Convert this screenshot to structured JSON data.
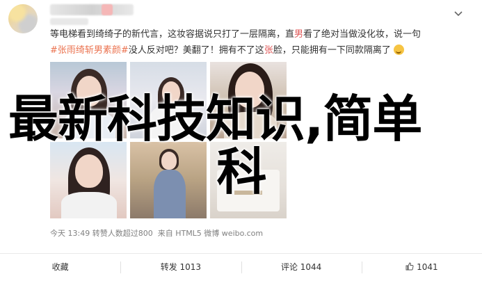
{
  "post": {
    "line1": "等电梯看到绮绮子的新代言，这妆容据说只打了一层隔离，直",
    "line1_red": "男",
    "line1_tail": "看了绝对当做没化妆，说一句",
    "tag": "#张雨绮斩男素颜#",
    "line2_mid": "没人反对吧？美翻了！拥有不了这",
    "line2_red": "张",
    "line2_tail": "脸，只能拥有一下同款隔离了",
    "meta": "今天 13:49 转赞人数超过800",
    "meta_sep": "来自 HTML5 微博 weibo.com"
  },
  "overlay": {
    "line1": "最新科技知识,简单",
    "line2": "科"
  },
  "footer": {
    "collect": "收藏",
    "repost": "转发 1013",
    "comment": "评论 1044",
    "like": "1041"
  },
  "colors": {
    "tag": "#eb7350",
    "accent_red": "#e05757",
    "muted": "#808080"
  }
}
